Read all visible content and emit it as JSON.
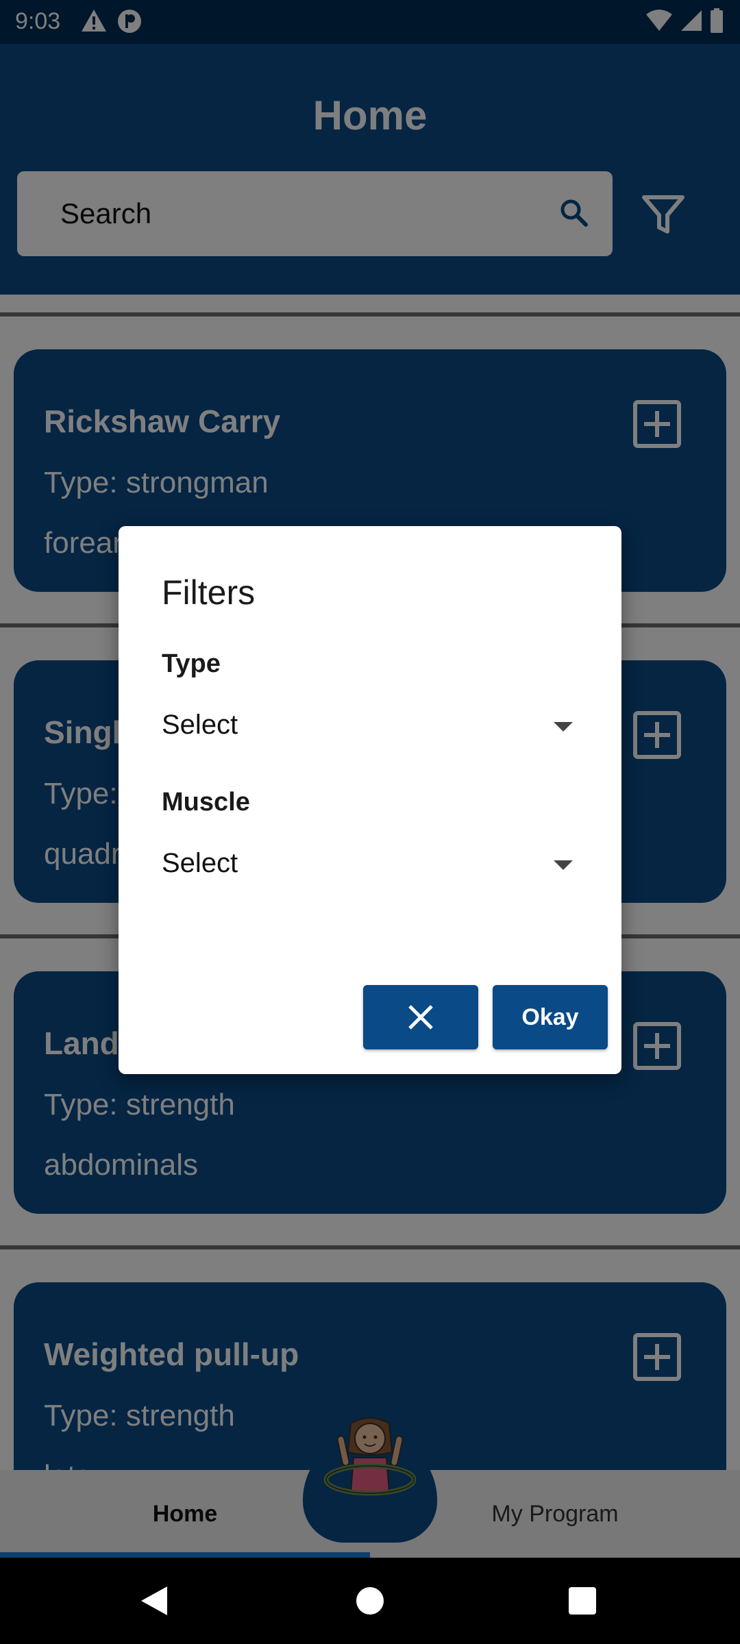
{
  "status_bar": {
    "time": "9:03",
    "left_icons": [
      "warning-icon",
      "privacy-icon"
    ],
    "right_icons": [
      "wifi-icon",
      "signal-icon",
      "battery-icon"
    ]
  },
  "header": {
    "title": "Home",
    "search_placeholder": "Search",
    "search_icon": "search-icon",
    "filter_icon": "filter-icon"
  },
  "exercises": [
    {
      "title": "Rickshaw Carry",
      "type": "Type: strongman",
      "muscle": "forearms"
    },
    {
      "title": "Single-Leg Press",
      "type": "Type: strength",
      "muscle": "quadriceps"
    },
    {
      "title": "Landmine twist",
      "type": "Type: strength",
      "muscle": "abdominals"
    },
    {
      "title": "Weighted pull-up",
      "type": "Type: strength",
      "muscle": "lats"
    }
  ],
  "bottom_nav": {
    "home_label": "Home",
    "program_label": "My Program",
    "active": "Home"
  },
  "dialog": {
    "title": "Filters",
    "type_label": "Type",
    "type_value": "Select",
    "muscle_label": "Muscle",
    "muscle_value": "Select",
    "cancel_icon": "close-icon",
    "okay_label": "Okay"
  },
  "colors": {
    "primary": "#0a4a86",
    "status_bar": "#002c54",
    "indicator": "#1f7ae0"
  }
}
